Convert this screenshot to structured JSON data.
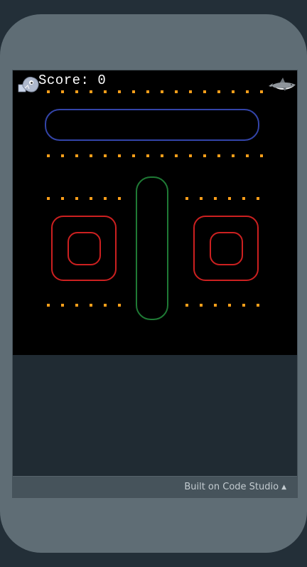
{
  "game": {
    "score_text": "Score: 0",
    "pellet_color": "#ff9f1a",
    "wall_colors": {
      "top": "#3344a8",
      "side_boxes": "#cc2020",
      "center": "#1f7a35"
    },
    "player_icon": "player-ghost-icon",
    "enemy_icon": "shark-icon"
  },
  "footer": {
    "label": "Built on Code Studio",
    "caret": "▲"
  }
}
